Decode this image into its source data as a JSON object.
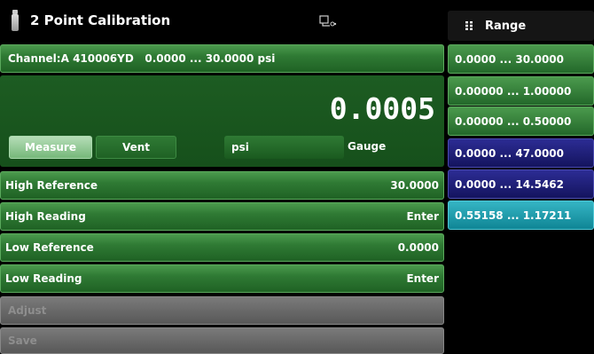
{
  "header": {
    "title": "2 Point Calibration",
    "range_title": "Range"
  },
  "channel": {
    "label": "Channel:A",
    "serial": "410006YD",
    "range": "0.0000 ... 30.0000 psi"
  },
  "reading": {
    "value": "0.0005"
  },
  "controls": {
    "measure_label": "Measure",
    "vent_label": "Vent",
    "unit": "psi",
    "mode": "Gauge"
  },
  "rows": [
    {
      "label": "High Reference",
      "value": "30.0000"
    },
    {
      "label": "High Reading",
      "value": "Enter"
    },
    {
      "label": "Low Reference",
      "value": "0.0000"
    },
    {
      "label": "Low Reading",
      "value": "Enter"
    }
  ],
  "disabled": {
    "adjust_label": "Adjust",
    "save_label": "Save"
  },
  "ranges": [
    {
      "label": "0.0000 ... 30.0000",
      "color": "#3d8c42"
    },
    {
      "label": "0.00000 ... 1.00000",
      "color": "#3d8c42"
    },
    {
      "label": "0.00000 ... 0.50000",
      "color": "#3d8c42"
    },
    {
      "label": "0.0000 ... 47.0000",
      "color": "#22227a"
    },
    {
      "label": "0.0000 ... 14.5462",
      "color": "#22227a"
    },
    {
      "label": "0.55158 ... 1.17211",
      "color": "#1ea0b0"
    }
  ],
  "icons": {
    "title_icon": "sensor-icon",
    "status_icon": "connection-icon",
    "range_icon": "grid-icon"
  }
}
